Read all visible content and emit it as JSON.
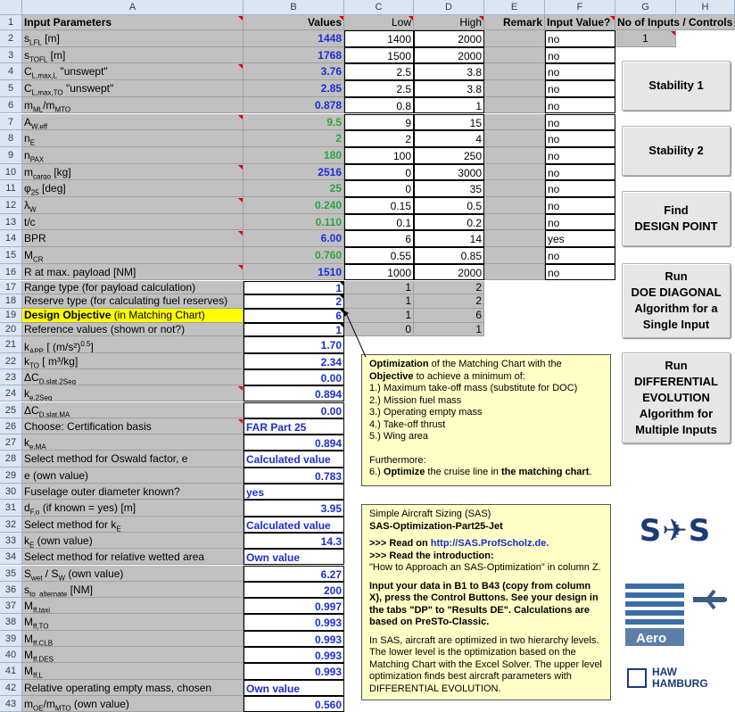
{
  "columns": [
    "A",
    "B",
    "C",
    "D",
    "E",
    "F",
    "G",
    "H"
  ],
  "row_numbers": [
    "1",
    "2",
    "3",
    "4",
    "5",
    "6",
    "7",
    "8",
    "9",
    "10",
    "11",
    "12",
    "13",
    "14",
    "15",
    "16",
    "17",
    "18",
    "19",
    "20",
    "21",
    "22",
    "23",
    "24",
    "25",
    "26",
    "27",
    "28",
    "29",
    "30",
    "31",
    "32",
    "33",
    "34",
    "35",
    "36",
    "37",
    "38",
    "39",
    "40",
    "41",
    "42",
    "43"
  ],
  "headers": {
    "a": "Input Parameters",
    "b": "Values",
    "c": "Low",
    "d": "High",
    "e": "Remark",
    "f": "Input Value?",
    "gh": "No of Inputs / Controls"
  },
  "no_of_inputs": "1",
  "params": [
    {
      "name": "s",
      "sub": "LFL",
      "suffix": " [m]",
      "value": "1448",
      "color": "blue",
      "low": "1400",
      "high": "2000",
      "input": "no"
    },
    {
      "name": "s",
      "sub": "TOFL",
      "suffix": " [m]",
      "value": "1768",
      "color": "blue",
      "low": "1500",
      "high": "2000",
      "input": "no"
    },
    {
      "name": "C",
      "sub": "L,max,L",
      "suffix": " \"unswept\"",
      "value": "3.76",
      "color": "blue",
      "low": "2.5",
      "high": "3.8",
      "input": "no"
    },
    {
      "name": "C",
      "sub": "L,max,TO",
      "suffix": " \"unswept\"",
      "value": "2.85",
      "color": "blue",
      "low": "2.5",
      "high": "3.8",
      "input": "no"
    },
    {
      "name": "m",
      "sub": "ML",
      "suffix": "/m",
      "sub2": "MTO",
      "value": "0.878",
      "color": "blue",
      "low": "0.8",
      "high": "1",
      "input": "no"
    },
    {
      "name": "A",
      "sub": "W,eff",
      "suffix": "",
      "value": "9.5",
      "color": "green",
      "low": "9",
      "high": "15",
      "input": "no"
    },
    {
      "name": "n",
      "sub": "E",
      "suffix": "",
      "value": "2",
      "color": "green",
      "low": "2",
      "high": "4",
      "input": "no"
    },
    {
      "name": "n",
      "sub": "PAX",
      "suffix": "",
      "value": "180",
      "color": "green",
      "low": "100",
      "high": "250",
      "input": "no"
    },
    {
      "name": "m",
      "sub": "cargo",
      "suffix": " [kg]",
      "value": "2516",
      "color": "blue",
      "low": "0",
      "high": "3000",
      "input": "no"
    },
    {
      "name": "φ",
      "sub": "25",
      "suffix": " [deg]",
      "value": "25",
      "color": "green",
      "low": "0",
      "high": "35",
      "input": "no"
    },
    {
      "name": "λ",
      "sub": "W",
      "suffix": "",
      "value": "0.240",
      "color": "green",
      "low": "0.15",
      "high": "0.5",
      "input": "no"
    },
    {
      "name": "t/c",
      "sub": "",
      "suffix": "",
      "value": "0.110",
      "color": "green",
      "low": "0.1",
      "high": "0.2",
      "input": "no"
    },
    {
      "name": "BPR",
      "sub": "",
      "suffix": "",
      "value": "6.00",
      "color": "blue",
      "low": "6",
      "high": "14",
      "input": "yes"
    },
    {
      "name": "M",
      "sub": "CR",
      "suffix": "",
      "value": "0.760",
      "color": "green",
      "low": "0.55",
      "high": "0.85",
      "input": "no"
    },
    {
      "name": "R at max. payload [NM]",
      "sub": "",
      "suffix": "",
      "value": "1510",
      "color": "blue",
      "low": "1000",
      "high": "2000",
      "input": "no"
    }
  ],
  "settings": [
    {
      "label": "Range type (for payload calculation)",
      "value": "1",
      "low": "1",
      "high": "2"
    },
    {
      "label": "Reserve type (for calculating fuel reserves)",
      "value": "2",
      "low": "1",
      "high": "2"
    },
    {
      "label_bold": "Design Objective",
      "label_rest": " (in Matching Chart)",
      "value": "6",
      "low": "1",
      "high": "6"
    },
    {
      "label": "Reference values (shown or not?)",
      "value": "1",
      "low": "0",
      "high": "1"
    }
  ],
  "lower": [
    {
      "html": "k<sub>APP</sub> [ (m/s²)<sup>0.5</sup>]",
      "value": "1.70"
    },
    {
      "html": "k<sub>TO</sub> [ m³/kg]",
      "value": "2.34"
    },
    {
      "html": "ΔC<sub>D,slat,2Seg</sub>",
      "value": "0.00"
    },
    {
      "html": "k<sub>e,2Seg</sub>",
      "value": "0.894"
    },
    {
      "html": "ΔC<sub>D,slat,MA</sub>",
      "value": "0.00"
    },
    {
      "html": "Choose: Certification basis",
      "value": "FAR Part 25",
      "align": "left"
    },
    {
      "html": "k<sub>e,MA</sub>",
      "value": "0.894"
    },
    {
      "html": "Select method for Oswald factor, e",
      "value": "Calculated value",
      "align": "left"
    },
    {
      "html": "e (own value)",
      "value": "0.783"
    },
    {
      "html": "Fuselage outer diameter known?",
      "value": "yes",
      "align": "left"
    },
    {
      "html": "d<sub>F,o</sub> (if known = yes) [m]",
      "value": "3.95"
    },
    {
      "html": "Select method for k<sub>E</sub>",
      "value": "Calculated value",
      "align": "left"
    },
    {
      "html": "k<sub>E</sub> (own value)",
      "value": "14.3"
    },
    {
      "html": "Select method for relative wetted area",
      "value": "Own value",
      "align": "left"
    },
    {
      "html": "S<sub>wet</sub> / S<sub>W</sub> (own value)",
      "value": "6.27"
    },
    {
      "html": "s<sub>to_alternate</sub> [NM]",
      "value": "200"
    },
    {
      "html": "M<sub>ff,taxi</sub>",
      "value": "0.997"
    },
    {
      "html": "M<sub>ff,TO</sub>",
      "value": "0.993"
    },
    {
      "html": "M<sub>ff,CLB</sub>",
      "value": "0.993"
    },
    {
      "html": "M<sub>ff,DES</sub>",
      "value": "0.993"
    },
    {
      "html": "M<sub>ff,L</sub>",
      "value": "0.993"
    },
    {
      "html": "Relative operating empty mass, chosen",
      "value": "Own value",
      "align": "left"
    },
    {
      "html": "m<sub>OE</sub>/m<sub>MTO</sub> (own value)",
      "value": "0.560"
    }
  ],
  "buttons": {
    "stability1": "Stability 1",
    "stability2": "Stability 2",
    "find_l1": "Find",
    "find_l2": "DESIGN POINT",
    "doe_l1": "Run",
    "doe_l2": "DOE DIAGONAL",
    "doe_l3": "Algorithm for a",
    "doe_l4": "Single Input",
    "de_l1": "Run",
    "de_l2": "DIFFERENTIAL",
    "de_l3": "EVOLUTION",
    "de_l4": "Algorithm for",
    "de_l5": "Multiple Inputs"
  },
  "note1": {
    "p1_b1": "Optimization",
    "p1_t1": " of the Matching Chart with the ",
    "p1_b2": "Objective",
    "p1_t2": " to achieve a minimum of:",
    "items": [
      "1.) Maximum take-off mass (substitute for DOC)",
      "2.) Mission fuel mass",
      "3.) Operating empty mass",
      "4.) Take-off thrust",
      "5.) Wing area"
    ],
    "furthermore": "Furthermore:",
    "p6_t1": "6.) ",
    "p6_b1": "Optimize",
    "p6_t2": " the cruise line in ",
    "p6_b2": "the matching chart",
    "p6_t3": "."
  },
  "note2": {
    "l1": "Simple Aircraft Sizing (SAS)",
    "l2": "SAS-Optimization-Part25-Jet",
    "l3a": ">>> Read on ",
    "l3b": "http://SAS.ProfScholz.de.",
    "l4a": ">>> Read the ",
    "l4b": "introduction",
    ":": "",
    "l4c": ":",
    "l5": "\"How to Approach an SAS-Optimization\" in column Z.",
    "p2": "Input your data in B1 to B43 (copy from column X), press the Control Buttons. See your design in the tabs \"DP\" to \"Results DE\". Calculations are based on PreSTo-Classic.",
    "p3": "In SAS, aircraft are optimized in two hierarchy levels. The lower level is the optimization based on the Matching Chart with the Excel Solver. The upper level optimization finds best aircraft parameters with DIFFERENTIAL EVOLUTION."
  },
  "logos": {
    "sas": "S✈S",
    "aero": "Aero",
    "haw1": "HAW",
    "haw2": "HAMBURG"
  },
  "colors": {
    "blue_value": "#1a2ed6",
    "green_value": "#2ea43a",
    "highlight": "#ffff00",
    "note": "#ffffc6",
    "sas_logo": "#1b3a78"
  }
}
